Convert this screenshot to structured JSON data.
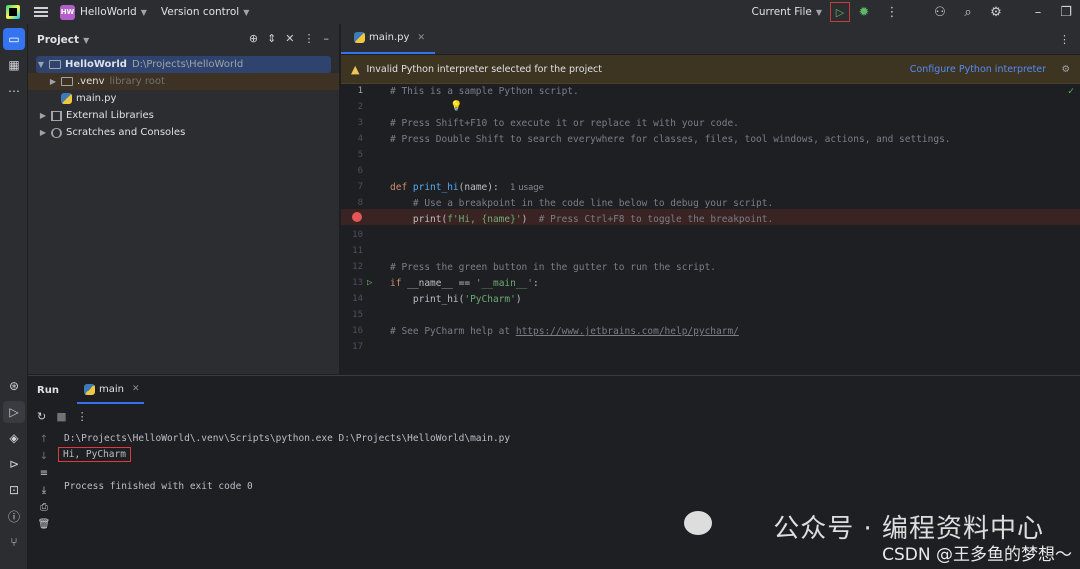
{
  "titlebar": {
    "project_badge": "HW",
    "project_name": "HelloWorld",
    "vcs": "Version control",
    "run_config": "Current File"
  },
  "project_panel": {
    "title": "Project",
    "tree": [
      {
        "label": "HelloWorld",
        "path": "D:\\Projects\\HelloWorld"
      },
      {
        "label": ".venv",
        "hint": "library root"
      },
      {
        "label": "main.py"
      },
      {
        "label": "External Libraries"
      },
      {
        "label": "Scratches and Consoles"
      }
    ]
  },
  "editor": {
    "tab": "main.py",
    "warning": "Invalid Python interpreter selected for the project",
    "warning_action": "Configure Python interpreter",
    "line_numbers": [
      "1",
      "2",
      "3",
      "4",
      "5",
      "6",
      "7",
      "8",
      "9",
      "10",
      "11",
      "12",
      "13",
      "14",
      "15",
      "16",
      "17"
    ],
    "code": {
      "l1": "# This is a sample Python script.",
      "l3": "# Press Shift+F10 to execute it or replace it with your code.",
      "l4": "# Press Double Shift to search everywhere for classes, files, tool windows, actions, and settings.",
      "l7_kw": "def ",
      "l7_fn": "print_hi",
      "l7_rest": "(name):",
      "l7_hint": "1 usage",
      "l8": "    # Use a breakpoint in the code line below to debug your script.",
      "l9_a": "    print(",
      "l9_str": "f'Hi, {name}'",
      "l9_b": ")  ",
      "l9_cm": "# Press Ctrl+F8 to toggle the breakpoint.",
      "l12": "# Press the green button in the gutter to run the script.",
      "l13_kw": "if ",
      "l13_mid": "__name__ == ",
      "l13_str": "'__main__'",
      "l13_end": ":",
      "l14_a": "    print_hi(",
      "l14_str": "'PyCharm'",
      "l14_b": ")",
      "l16_cm": "# See PyCharm help at ",
      "l16_link": "https://www.jetbrains.com/help/pycharm/"
    }
  },
  "run_panel": {
    "title": "Run",
    "tab": "main",
    "lines": [
      "D:\\Projects\\HelloWorld\\.venv\\Scripts\\python.exe D:\\Projects\\HelloWorld\\main.py",
      "Hi, PyCharm",
      "Process finished with exit code 0"
    ]
  },
  "watermark": {
    "line1": "公众号 · 编程资料中心",
    "line2": "CSDN @王多鱼的梦想～"
  }
}
